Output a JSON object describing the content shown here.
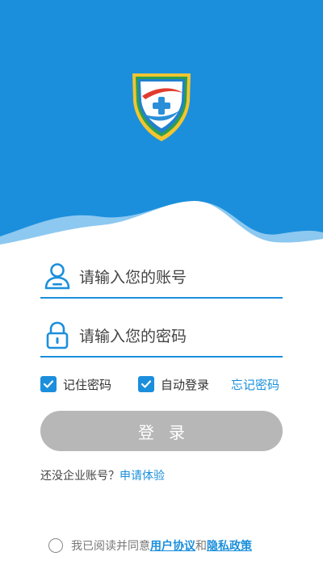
{
  "colors": {
    "primary": "#1b8fdc",
    "wave_light": "#8cc8f0",
    "button_disabled": "#b7b7b7"
  },
  "logo": {
    "icon": "shield-plus-icon"
  },
  "login": {
    "account_placeholder": "请输入您的账号",
    "password_placeholder": "请输入您的密码",
    "account_icon": "user-icon",
    "password_icon": "lock-icon",
    "remember_label": "记住密码",
    "remember_checked": true,
    "auto_login_label": "自动登录",
    "auto_login_checked": true,
    "forgot_label": "忘记密码",
    "submit_label": "登录"
  },
  "signup": {
    "question": "还没企业账号？",
    "link": "申请体验"
  },
  "agreement": {
    "checked": false,
    "prefix": "我已阅读并同意",
    "user_agreement": "用户协议",
    "conjunction": "和",
    "privacy_policy": "隐私政策"
  }
}
